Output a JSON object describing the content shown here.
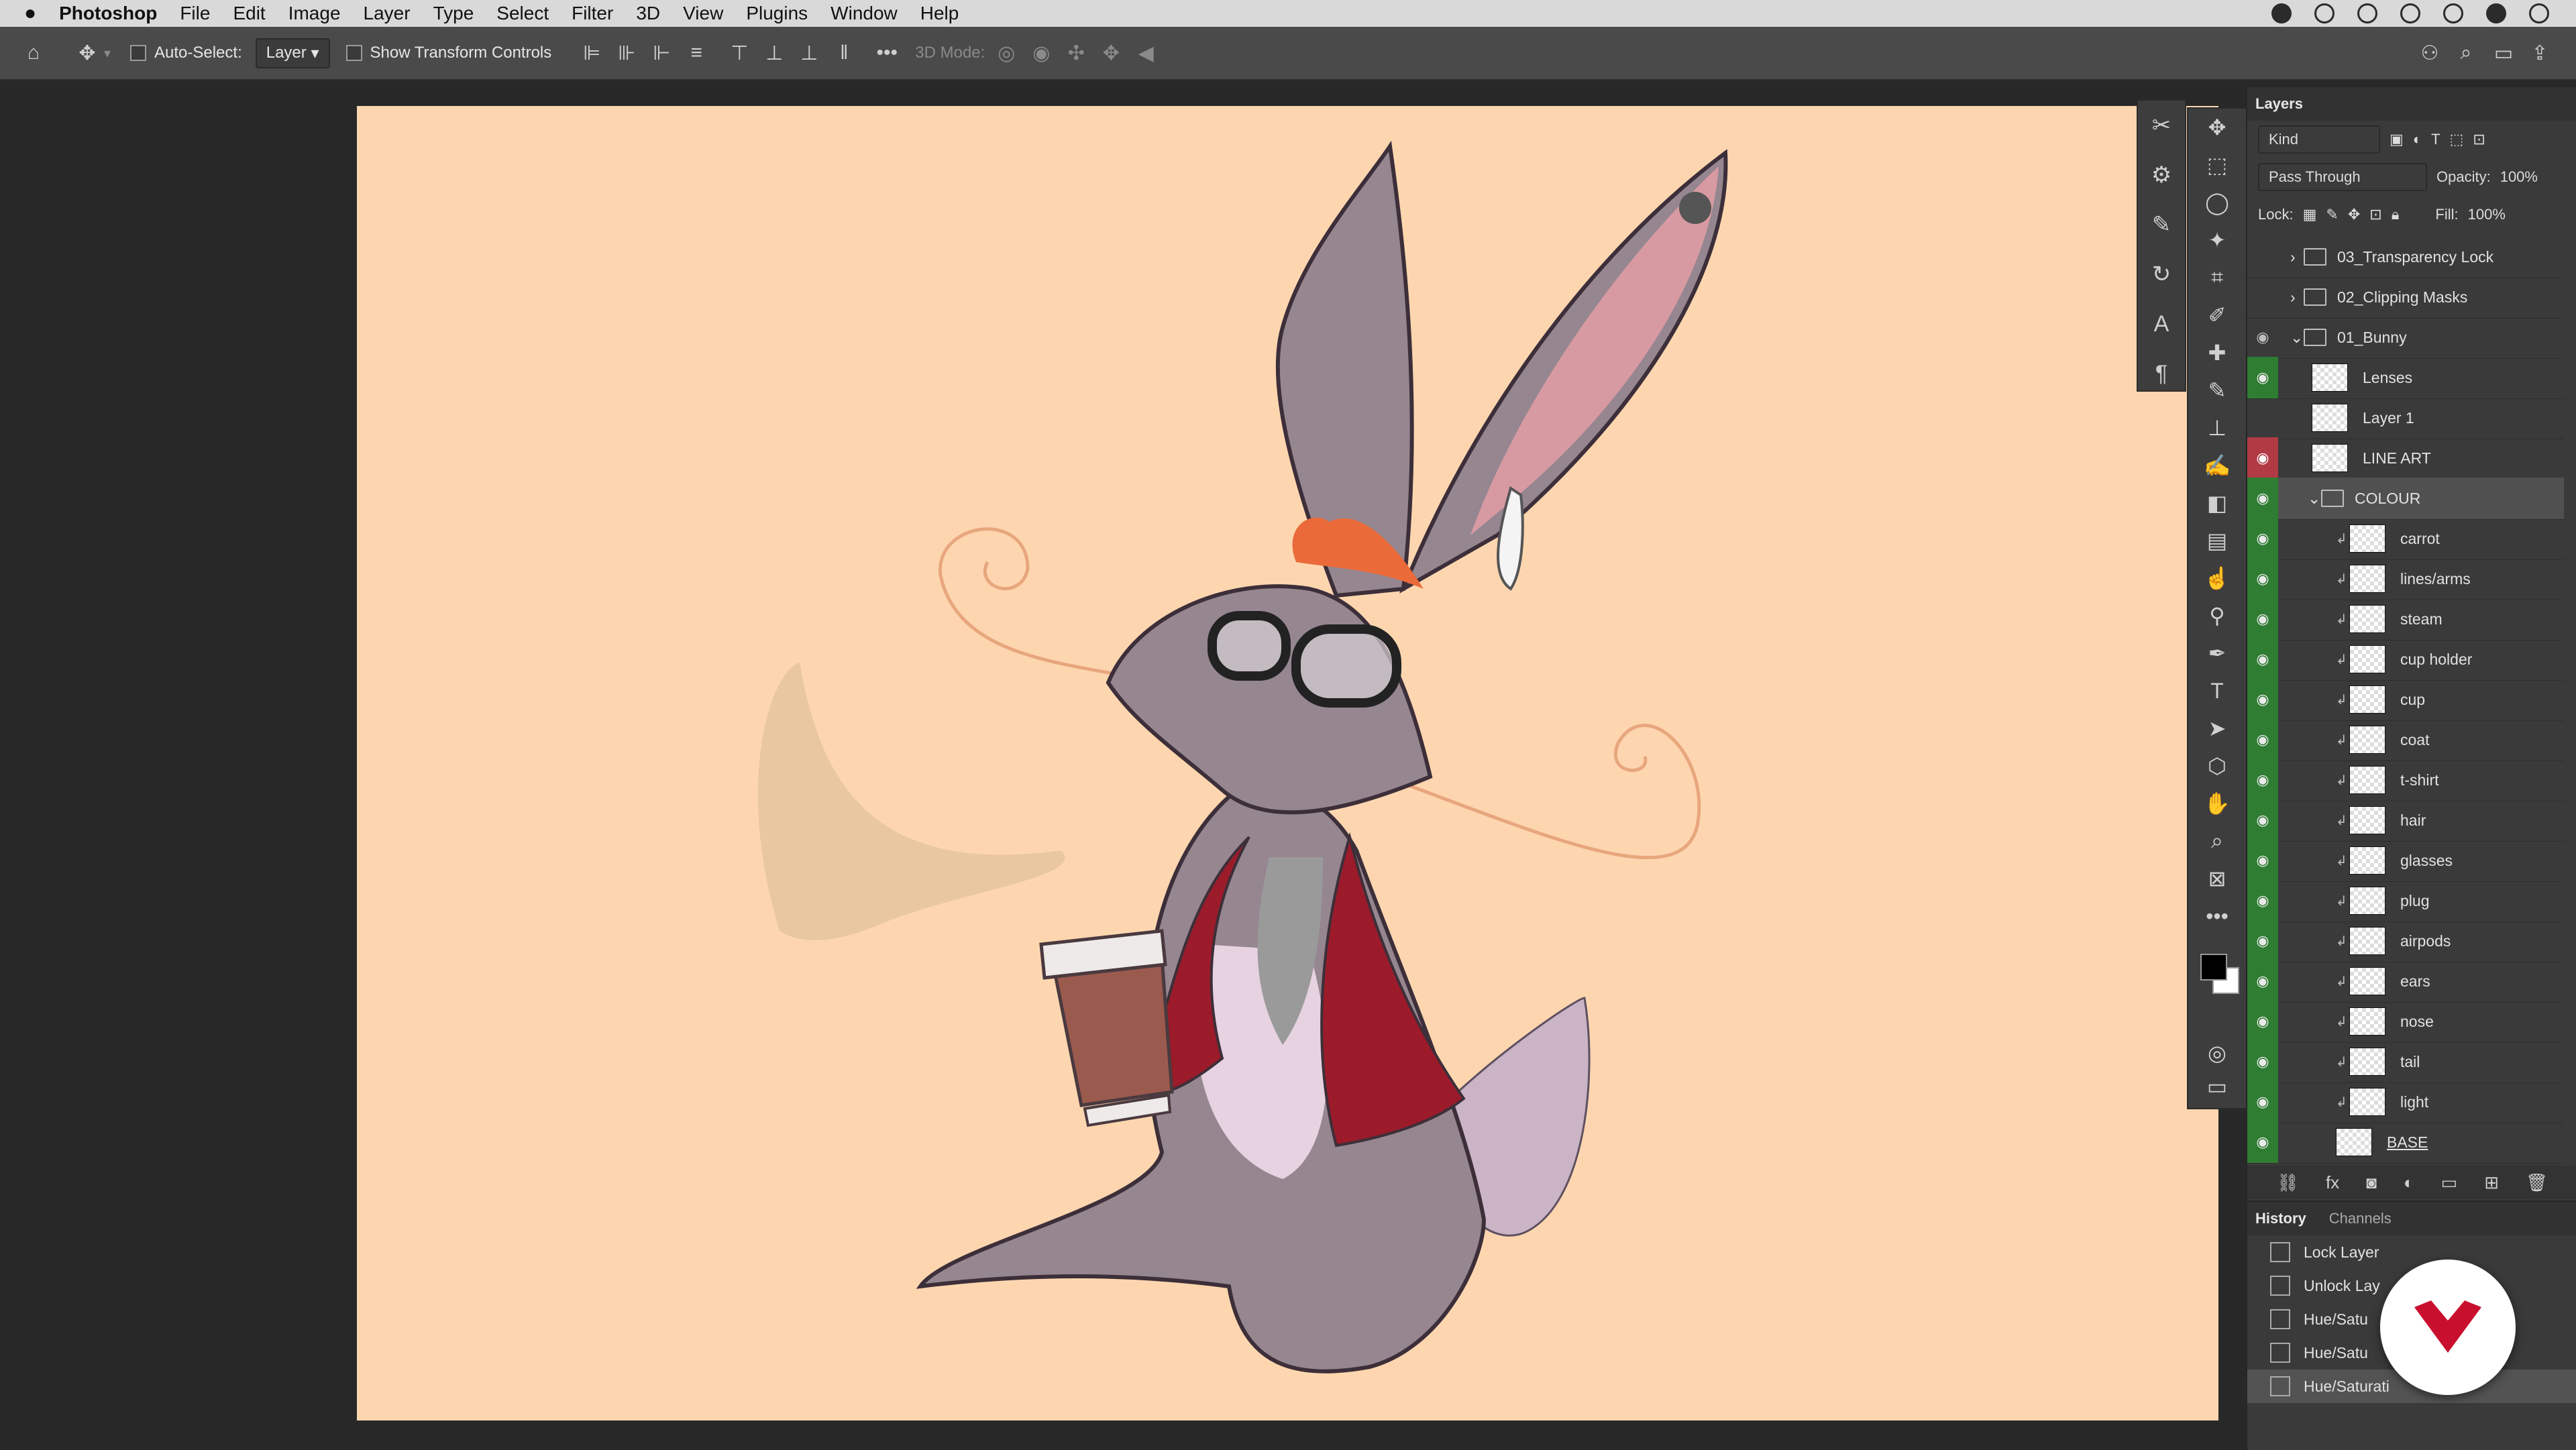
{
  "menubar": {
    "app": "Photoshop",
    "items": [
      "File",
      "Edit",
      "Image",
      "Layer",
      "Type",
      "Select",
      "Filter",
      "3D",
      "View",
      "Plugins",
      "Window",
      "Help"
    ]
  },
  "options": {
    "auto_select": "Auto-Select:",
    "target": "Layer",
    "show_transform": "Show Transform Controls",
    "mode_3d": "3D Mode:"
  },
  "layers_panel": {
    "title": "Layers",
    "filter_kind": "Kind",
    "blend_mode": "Pass Through",
    "opacity_label": "Opacity:",
    "opacity": "100%",
    "lock_label": "Lock:",
    "fill_label": "Fill:",
    "fill": "100%",
    "rows": [
      {
        "name": "03_Transparency Lock",
        "type": "group",
        "visible": false
      },
      {
        "name": "02_Clipping Masks",
        "type": "group",
        "visible": false
      },
      {
        "name": "01_Bunny",
        "type": "group",
        "visible": true
      },
      {
        "name": "Lenses",
        "type": "layer",
        "visible": true
      },
      {
        "name": "Layer 1",
        "type": "layer",
        "visible": false
      },
      {
        "name": "LINE ART",
        "type": "layer",
        "visible": true
      },
      {
        "name": "COLOUR",
        "type": "group",
        "visible": true
      },
      {
        "name": "carrot",
        "type": "clipped",
        "visible": true
      },
      {
        "name": "lines/arms",
        "type": "clipped",
        "visible": true
      },
      {
        "name": "steam",
        "type": "clipped",
        "visible": true
      },
      {
        "name": "cup holder",
        "type": "clipped",
        "visible": true
      },
      {
        "name": "cup",
        "type": "clipped",
        "visible": true
      },
      {
        "name": "coat",
        "type": "clipped",
        "visible": true
      },
      {
        "name": "t-shirt",
        "type": "clipped",
        "visible": true
      },
      {
        "name": "hair",
        "type": "clipped",
        "visible": true
      },
      {
        "name": "glasses",
        "type": "clipped",
        "visible": true
      },
      {
        "name": "plug",
        "type": "clipped",
        "visible": true
      },
      {
        "name": "airpods",
        "type": "clipped",
        "visible": true
      },
      {
        "name": "ears",
        "type": "clipped",
        "visible": true
      },
      {
        "name": "nose",
        "type": "clipped",
        "visible": true
      },
      {
        "name": "tail",
        "type": "clipped",
        "visible": true
      },
      {
        "name": "light",
        "type": "clipped",
        "visible": true
      },
      {
        "name": "BASE",
        "type": "base",
        "visible": true
      }
    ]
  },
  "history_panel": {
    "tabs": [
      "History",
      "Channels"
    ],
    "items": [
      "Lock Layer",
      "Unlock Lay",
      "Hue/Satu",
      "Hue/Satu",
      "Hue/Saturati"
    ]
  },
  "colors": {
    "canvas_bg": "#fdd6b0",
    "eye_green": "#2f7d33",
    "eye_red": "#b23a44"
  }
}
